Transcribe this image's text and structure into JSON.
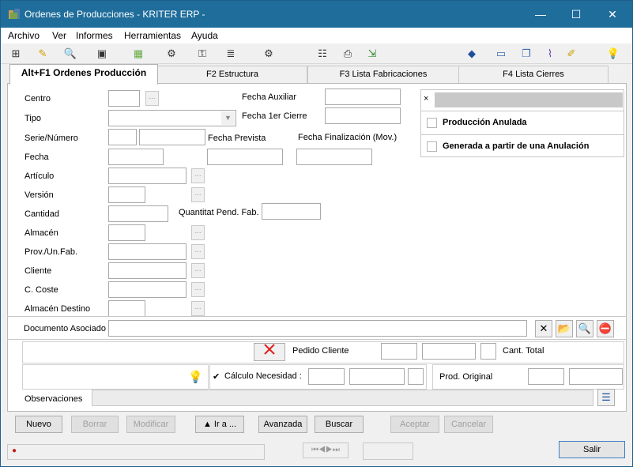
{
  "window": {
    "title": "Ordenes de Producciones - KRITER ERP -",
    "minimize": "—",
    "maximize": "☐",
    "close": "✕"
  },
  "menu": [
    "Archivo",
    "Ver",
    "Informes",
    "Herramientas",
    "Ayuda"
  ],
  "tabs": [
    "Alt+F1 Ordenes Producción",
    "F2 Estructura",
    "F3 Lista Fabricaciones",
    "F4 Lista Cierres"
  ],
  "form": {
    "centro": "Centro",
    "tipo": "Tipo",
    "serie_numero": "Serie/Número",
    "fecha": "Fecha",
    "articulo": "Artículo",
    "version": "Versión",
    "cantidad": "Cantidad",
    "almacen": "Almacén",
    "prov_un_fab": "Prov./Un.Fab.",
    "cliente": "Cliente",
    "c_coste": "C. Coste",
    "almacen_destino": "Almacén Destino",
    "fecha_auxiliar": "Fecha Auxiliar",
    "fecha_1er_cierre": "Fecha 1er Cierre",
    "fecha_prevista": "Fecha Prevista",
    "fecha_finalizacion": "Fecha Finalización (Mov.)",
    "quantitat_pend_fab": "Quantitat Pend. Fab.",
    "documento_asociado": "Documento Asociado",
    "pedido_cliente": "Pedido Cliente",
    "cant_total": "Cant. Total",
    "calculo_necesidad": "Cálculo Necesidad :",
    "prod_original": "Prod. Original",
    "observaciones": "Observaciones",
    "dots": "...",
    "x_mark": "×"
  },
  "flags": {
    "produccion_anulada": "Producción Anulada",
    "generada_anulacion": "Generada a partir de una Anulación"
  },
  "buttons": {
    "nuevo": "Nuevo",
    "borrar": "Borrar",
    "modificar": "Modificar",
    "ir_a": "▲ Ir a ...",
    "avanzada": "Avanzada",
    "buscar": "Buscar",
    "aceptar": "Aceptar",
    "cancelar": "Cancelar",
    "salir": "Salir"
  },
  "colors": {
    "titlebar": "#1f6d9b",
    "red_x": "#e02020"
  }
}
